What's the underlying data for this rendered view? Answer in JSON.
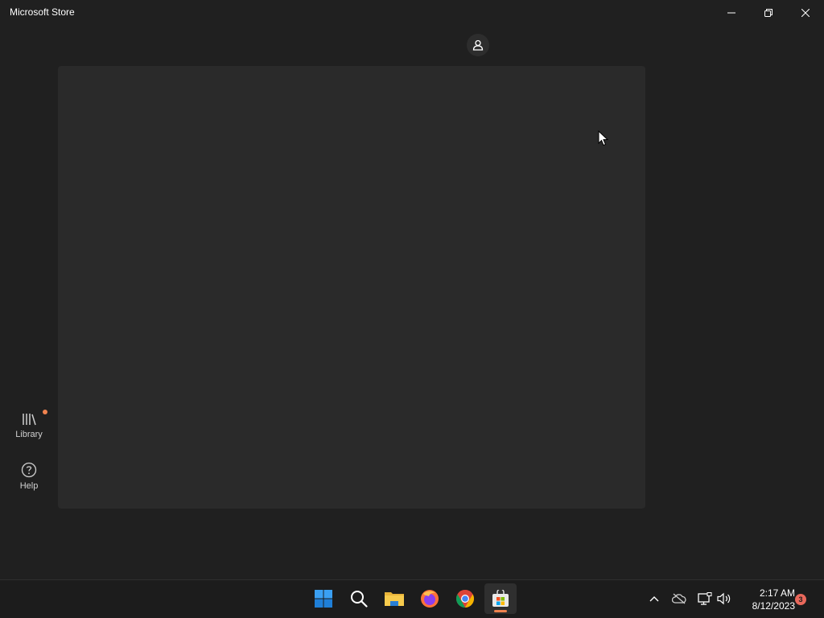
{
  "window": {
    "title": "Microsoft Store"
  },
  "sidebar": {
    "items": [
      {
        "label": "Library",
        "icon": "library-icon",
        "has_badge": true
      },
      {
        "label": "Help",
        "icon": "help-icon"
      }
    ]
  },
  "taskbar": {
    "apps": [
      {
        "name": "start",
        "icon": "windows-start-icon"
      },
      {
        "name": "search",
        "icon": "search-icon"
      },
      {
        "name": "file-explorer",
        "icon": "folder-icon"
      },
      {
        "name": "firefox",
        "icon": "firefox-icon"
      },
      {
        "name": "chrome",
        "icon": "chrome-icon"
      },
      {
        "name": "microsoft-store",
        "icon": "store-icon",
        "active": true
      }
    ],
    "tray": {
      "icons": [
        "chevron-up-icon",
        "onedrive-offline-icon",
        "network-icon",
        "volume-icon"
      ],
      "time": "2:17 AM",
      "date": "8/12/2023",
      "notification_count": "3"
    }
  },
  "colors": {
    "background": "#202020",
    "panel": "#2a2a2a",
    "taskbar": "#1c1c1c",
    "accent": "#f0834f",
    "notification": "#e9685b"
  }
}
